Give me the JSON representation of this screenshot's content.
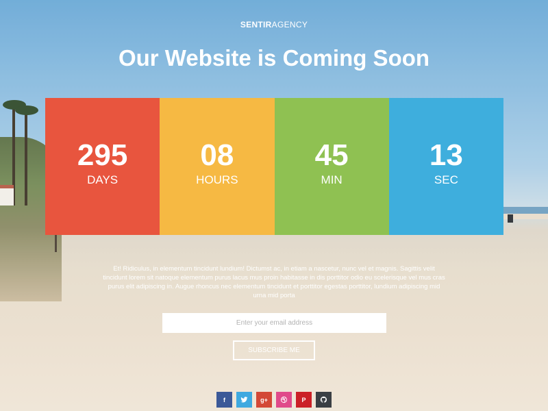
{
  "header": {
    "brand_bold": "SENTIR",
    "brand_regular": "AGENCY",
    "title": "Our Website is Coming Soon"
  },
  "countdown": [
    {
      "value": "295",
      "label": "DAYS",
      "color": "#e8553e"
    },
    {
      "value": "08",
      "label": "HOURS",
      "color": "#f6b943"
    },
    {
      "value": "45",
      "label": "MIN",
      "color": "#8fc152"
    },
    {
      "value": "13",
      "label": "SEC",
      "color": "#3eaedd"
    }
  ],
  "description": "Et! Ridiculus, in elementum tincidunt lundium! Dictumst ac, in etiam a nascetur, nunc vel et magnis. Sagittis velit tincidunt lorem sit natoque elementum purus lacus mus proin habitasse in dis porttitor odio eu scelerisque vel mus cras purus elit adipiscing in. Augue rhoncus nec elementum tincidunt et porttitor egestas porttitor, lundium adipiscing mid urna mid porta",
  "subscribe": {
    "placeholder": "Enter your email address",
    "button_label": "SUBSCRIBE ME"
  },
  "social": [
    {
      "name": "facebook-icon",
      "glyph": "f",
      "color": "#3b5998"
    },
    {
      "name": "twitter-icon",
      "glyph": "",
      "color": "#3fa9e0"
    },
    {
      "name": "google-plus-icon",
      "glyph": "g+",
      "color": "#d34836"
    },
    {
      "name": "dribbble-icon",
      "glyph": "",
      "color": "#e04a8a"
    },
    {
      "name": "pinterest-icon",
      "glyph": "P",
      "color": "#cb2027"
    },
    {
      "name": "github-icon",
      "glyph": "",
      "color": "#3a3f44"
    }
  ]
}
